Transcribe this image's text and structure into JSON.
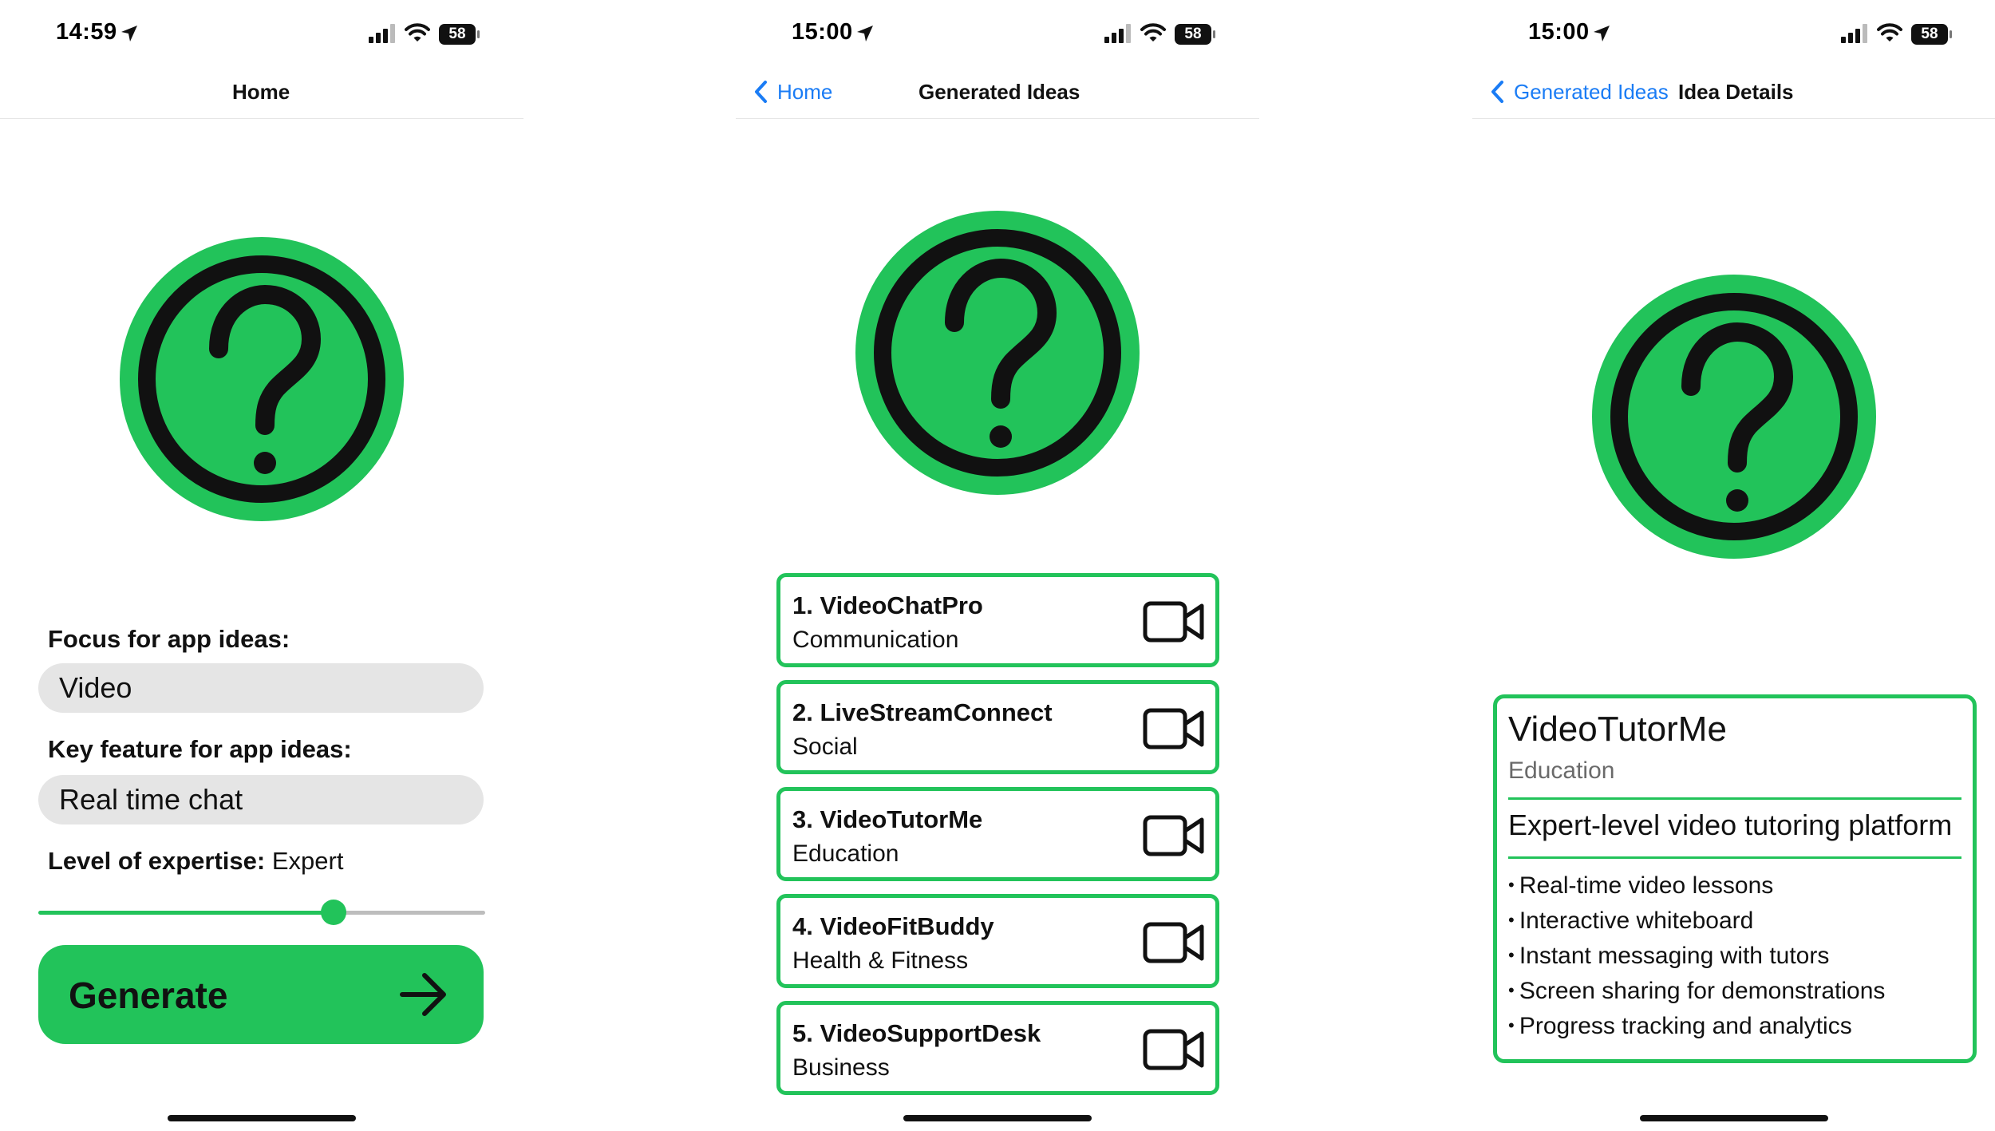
{
  "colors": {
    "accent": "#22c35a",
    "link": "#1a7cf5",
    "dark": "#111111",
    "field": "#e5e5e5"
  },
  "screens": [
    {
      "status": {
        "time": "14:59",
        "battery": "58"
      },
      "nav": {
        "title": "Home"
      },
      "hero_icon": "question-circle-icon",
      "form": {
        "focus_label": "Focus for app ideas:",
        "focus_value": "Video",
        "feature_label": "Key feature for app ideas:",
        "feature_value": "Real time chat",
        "expertise_label": "Level of expertise:",
        "expertise_value": "Expert",
        "expertise_slider_fraction": 0.66,
        "generate_label": "Generate",
        "generate_icon": "arrow-right-icon"
      }
    },
    {
      "status": {
        "time": "15:00",
        "battery": "58"
      },
      "nav": {
        "back": "Home",
        "title": "Generated Ideas"
      },
      "hero_icon": "question-circle-icon",
      "ideas": [
        {
          "title": "1. VideoChatPro",
          "category": "Communication",
          "icon": "video-camera-icon"
        },
        {
          "title": "2. LiveStreamConnect",
          "category": "Social",
          "icon": "video-camera-icon"
        },
        {
          "title": "3. VideoTutorMe",
          "category": "Education",
          "icon": "video-camera-icon"
        },
        {
          "title": "4. VideoFitBuddy",
          "category": "Health & Fitness",
          "icon": "video-camera-icon"
        },
        {
          "title": "5. VideoSupportDesk",
          "category": "Business",
          "icon": "video-camera-icon"
        }
      ]
    },
    {
      "status": {
        "time": "15:00",
        "battery": "58"
      },
      "nav": {
        "back": "Generated Ideas",
        "title": "Idea Details"
      },
      "hero_icon": "question-circle-icon",
      "detail": {
        "name": "VideoTutorMe",
        "category": "Education",
        "tagline": "Expert-level video tutoring platform",
        "features": [
          "Real-time video lessons",
          "Interactive whiteboard",
          "Instant messaging with tutors",
          "Screen sharing for demonstrations",
          "Progress tracking and analytics"
        ]
      }
    }
  ]
}
